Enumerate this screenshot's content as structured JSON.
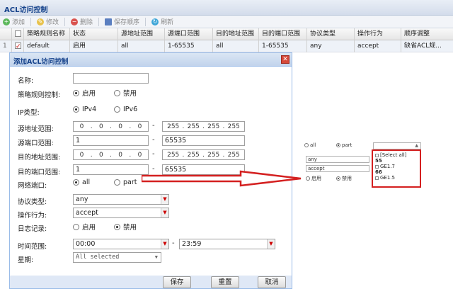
{
  "panel": {
    "title": "ACL访问控制"
  },
  "toolbar": {
    "add": "添加",
    "edit": "修改",
    "delete": "删除",
    "save_order": "保存顺序",
    "refresh": "刷新"
  },
  "grid": {
    "headers": [
      "策略规则名称",
      "状态",
      "源地址范围",
      "源端口范围",
      "目的地址范围",
      "目的端口范围",
      "协议类型",
      "操作行为",
      "顺序调整"
    ],
    "row": {
      "num": "1",
      "name": "default",
      "status": "启用",
      "src_addr": "all",
      "src_port": "1-65535",
      "dst_addr": "all",
      "dst_port": "1-65535",
      "protocol": "any",
      "action": "accept",
      "order": "缺省ACL规..."
    }
  },
  "dialog": {
    "title": "添加ACL访问控制",
    "labels": {
      "name": "名称:",
      "policy": "策略规则控制:",
      "ip_type": "IP类型:",
      "src_addr": "源地址范围:",
      "src_port": "源端口范围:",
      "dst_addr": "目的地址范围:",
      "dst_port": "目的端口范围:",
      "net_port": "网络端口:",
      "protocol": "协议类型:",
      "action": "操作行为:",
      "log": "日志记录:",
      "time": "时间范围:",
      "week": "星期:"
    },
    "policy_options": {
      "enable": "启用",
      "disable": "禁用"
    },
    "ip_options": {
      "v4": "IPv4",
      "v6": "IPv6"
    },
    "net_options": {
      "all": "all",
      "part": "part"
    },
    "log_options": {
      "enable": "启用",
      "disable": "禁用"
    },
    "src_ip_start": [
      "0",
      "0",
      "0",
      "0"
    ],
    "src_ip_end": [
      "255",
      "255",
      "255",
      "255"
    ],
    "dst_ip_start": [
      "0",
      "0",
      "0",
      "0"
    ],
    "dst_ip_end": [
      "255",
      "255",
      "255",
      "255"
    ],
    "src_port_start": "1",
    "src_port_end": "65535",
    "dst_port_start": "1",
    "dst_port_end": "65535",
    "dash": "-",
    "protocol_value": "any",
    "action_value": "accept",
    "time_start": "00:00",
    "time_end": "23:59",
    "week_value": "All selected",
    "buttons": {
      "save": "保存",
      "reset": "重置",
      "cancel": "取消"
    }
  },
  "inset": {
    "net_all": "all",
    "net_part": "part",
    "protocol": "any",
    "action": "accept",
    "log_enable": "启用",
    "log_disable": "禁用",
    "ports": [
      "[Select all]",
      "55",
      "GE1.7",
      "66",
      "GE1.5"
    ]
  },
  "colors": {
    "arrow": "#d42020",
    "title_text": "#15428b"
  }
}
